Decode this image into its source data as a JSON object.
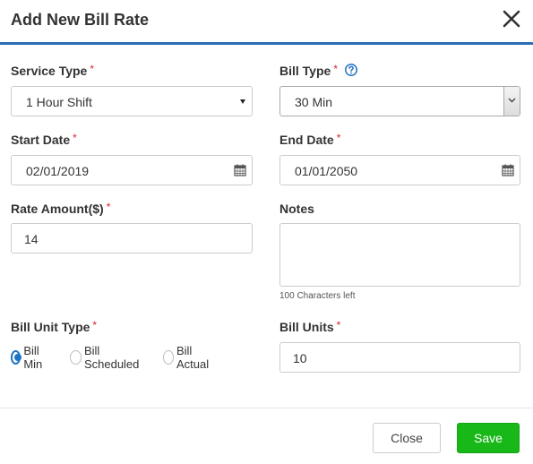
{
  "dialog": {
    "title": "Add New Bill Rate"
  },
  "form": {
    "service_type": {
      "label": "Service Type",
      "required": "*",
      "value": "1 Hour Shift"
    },
    "bill_type": {
      "label": "Bill Type",
      "required": "*",
      "value": "30 Min"
    },
    "start_date": {
      "label": "Start Date",
      "required": "*",
      "value": "02/01/2019"
    },
    "end_date": {
      "label": "End Date",
      "required": "*",
      "value": "01/01/2050"
    },
    "rate_amount": {
      "label": "Rate Amount($)",
      "required": "*",
      "value": "14"
    },
    "notes": {
      "label": "Notes",
      "value": "",
      "helper": "100 Characters left"
    },
    "bill_unit_type": {
      "label": "Bill Unit Type",
      "required": "*",
      "options": [
        "Bill Min",
        "Bill Scheduled",
        "Bill Actual"
      ],
      "selected": "Bill Min"
    },
    "bill_units": {
      "label": "Bill Units",
      "required": "*",
      "value": "10"
    }
  },
  "footer": {
    "close_label": "Close",
    "save_label": "Save"
  },
  "colors": {
    "accent": "#2a6db5",
    "required": "#d9232d",
    "save": "#18b818",
    "radio": "#1e74c4"
  },
  "icons": {
    "close": "close-icon",
    "help": "help-circle-icon",
    "calendar": "calendar-icon",
    "dropdown": "chevron-down-icon"
  }
}
